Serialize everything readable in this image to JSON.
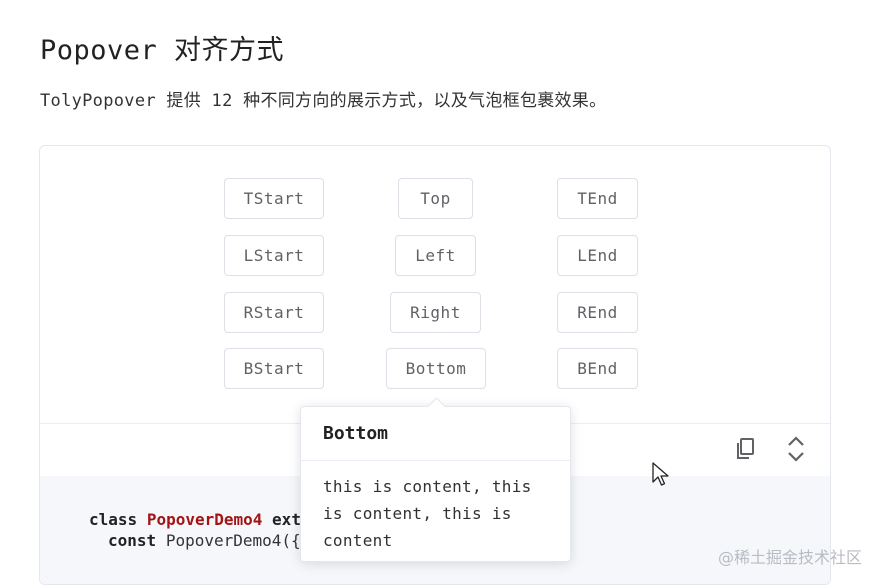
{
  "header": {
    "title": "Popover 对齐方式",
    "description": "TolyPopover 提供 12 种不同方向的展示方式，以及气泡框包裹效果。"
  },
  "demo": {
    "buttons": [
      {
        "label": "TStart"
      },
      {
        "label": "Top"
      },
      {
        "label": "TEnd"
      },
      {
        "label": "LStart"
      },
      {
        "label": "Left"
      },
      {
        "label": "LEnd"
      },
      {
        "label": "RStart"
      },
      {
        "label": "Right"
      },
      {
        "label": "REnd"
      },
      {
        "label": "BStart"
      },
      {
        "label": "Bottom"
      },
      {
        "label": "BEnd"
      }
    ],
    "toolbar": {
      "copy_icon": "copy-icon",
      "expand_icon": "expand-collapse-icon"
    }
  },
  "code": {
    "line1_keyword": "class",
    "line1_class": "PopoverDemo4",
    "line1_rest": "exte",
    "line2_keyword": "const",
    "line2_rest": "PopoverDemo4({s"
  },
  "popover": {
    "title": "Bottom",
    "content": "this is content, this is content, this is content"
  },
  "watermark": "@稀土掘金技术社区",
  "colors": {
    "class_name": "#a31515",
    "border": "#dcdfe6",
    "code_bg": "#f5f7fa"
  }
}
